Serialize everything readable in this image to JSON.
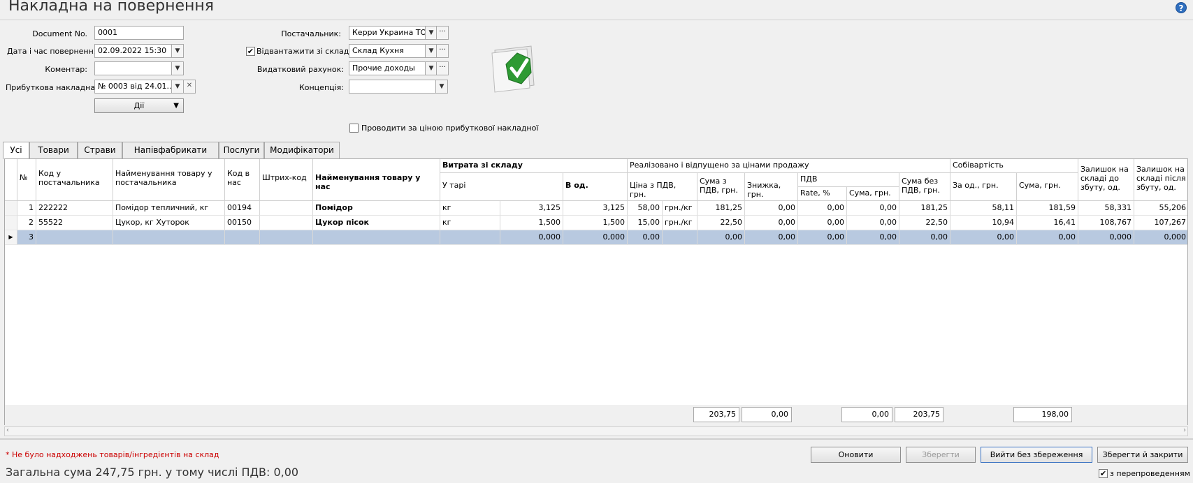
{
  "title": "Накладна на повернення",
  "form": {
    "doc_no_label": "Document No.",
    "doc_no_value": "0001",
    "date_label": "Дата і час повернення",
    "date_value": "02.09.2022 15:30",
    "comment_label": "Коментар:",
    "comment_value": "",
    "receipt_label": "Прибуткова накладна:",
    "receipt_value": "№ 0003 від 24.01...",
    "actions_label": "Дії",
    "supplier_label": "Постачальник:",
    "supplier_value": "Керри Украина ТОВ",
    "ship_from_label": "Відвантажити зі складу",
    "ship_from_checked": true,
    "ship_from_value": "Склад Кухня",
    "expense_label": "Видатковий рахунок:",
    "expense_value": "Прочие доходы",
    "concept_label": "Концепція:",
    "concept_value": "",
    "price_by_receipt_label": "Проводити за ціною прибуткової накладної",
    "price_by_receipt_checked": false,
    "status_icon": "green-check-document-icon",
    "more_glyph": "···"
  },
  "tabs": [
    "Усі",
    "Товари",
    "Страви",
    "Напівфабрикати",
    "Послуги",
    "Модифікатори"
  ],
  "active_tab": "Усі",
  "grid": {
    "headers": {
      "no": "№",
      "supplier_code": "Код у постачальника",
      "supplier_name": "Найменування товару у постачальника",
      "our_code": "Код в нас",
      "barcode": "Штрих-код",
      "our_name": "Найменування товару у нас",
      "writeoff_group": "Витрата зі складу",
      "in_pack": "У тарі",
      "in_units": "В од.",
      "sold_group": "Реалізовано і відпущено за цінами продажу",
      "price_vat": "Ціна з ПДВ, грн.",
      "sum_vat": "Сума з ПДВ, грн.",
      "discount": "Знижка, грн.",
      "vat_group": "ПДВ",
      "rate": "Rate, %",
      "vat_sum": "Сума, грн.",
      "sum_no_vat": "Сума без ПДВ, грн.",
      "cost_group": "Собівартість",
      "cost_unit": "За од., грн.",
      "cost_sum": "Сума, грн.",
      "stock_before": "Залишок на складі до збуту, од.",
      "stock_after": "Залишок на складі після збуту, од."
    },
    "rows": [
      {
        "no": "1",
        "supplier_code": "222222",
        "supplier_name": "Помідор тепличний, кг",
        "our_code": "00194",
        "barcode": "",
        "our_name": "Помідор",
        "unit": "кг",
        "in_pack": "3,125",
        "in_units": "3,125",
        "price": "58,00",
        "price_unit": "грн./кг",
        "sum_vat": "181,25",
        "discount": "0,00",
        "rate": "0,00",
        "vat_sum": "0,00",
        "sum_no_vat": "181,25",
        "cost_unit": "58,11",
        "cost_sum": "181,59",
        "stock_before": "58,331",
        "stock_after": "55,206"
      },
      {
        "no": "2",
        "supplier_code": "55522",
        "supplier_name": "Цукор, кг Хуторок",
        "our_code": "00150",
        "barcode": "",
        "our_name": "Цукор пісок",
        "unit": "кг",
        "in_pack": "1,500",
        "in_units": "1,500",
        "price": "15,00",
        "price_unit": "грн./кг",
        "sum_vat": "22,50",
        "discount": "0,00",
        "rate": "0,00",
        "vat_sum": "0,00",
        "sum_no_vat": "22,50",
        "cost_unit": "10,94",
        "cost_sum": "16,41",
        "stock_before": "108,767",
        "stock_after": "107,267"
      },
      {
        "no": "3",
        "supplier_code": "",
        "supplier_name": "",
        "our_code": "",
        "barcode": "",
        "our_name": "",
        "unit": "",
        "in_pack": "0,000",
        "in_units": "0,000",
        "price": "0,00",
        "price_unit": "",
        "sum_vat": "0,00",
        "discount": "0,00",
        "rate": "0,00",
        "vat_sum": "0,00",
        "sum_no_vat": "0,00",
        "cost_unit": "0,00",
        "cost_sum": "0,00",
        "stock_before": "0,000",
        "stock_after": "0,000"
      }
    ],
    "totals": {
      "sum_vat": "203,75",
      "discount": "0,00",
      "vat_sum": "0,00",
      "sum_no_vat": "203,75",
      "cost_sum": "198,00"
    }
  },
  "buttons": {
    "refresh": "Оновити",
    "save": "Зберегти",
    "exit_no_save": "Вийти без збереження",
    "save_close": "Зберегти й закрити"
  },
  "note": "* Не було надходжень товарів/інгредієнтів на склад",
  "total_text": "Загальна сума 247,75 грн. у тому числі ПДВ: 0,00",
  "repost_label": "з перепроведенням",
  "repost_checked": true
}
